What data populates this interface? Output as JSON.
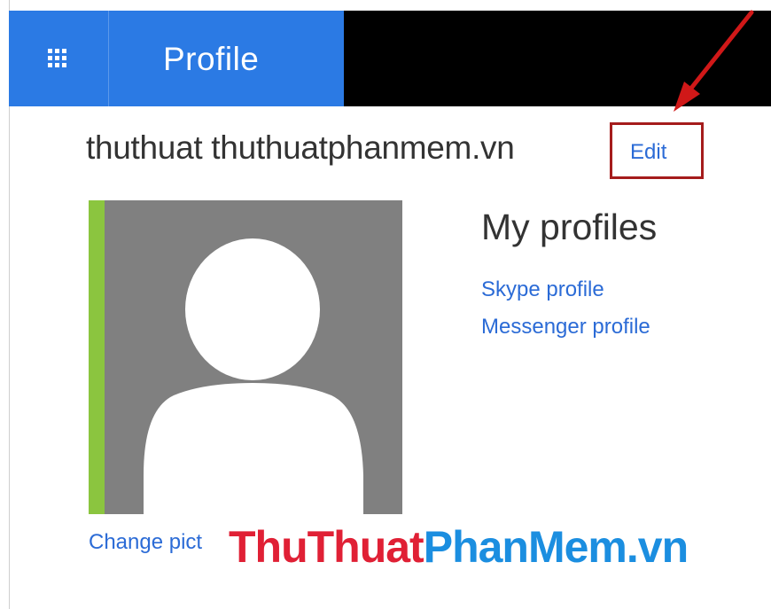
{
  "header": {
    "app_title": "Profile",
    "menu_icon": "waffle-grid-icon",
    "brand_color": "#2b7ae4"
  },
  "profile": {
    "display_name": "thuthuat thuthuatphanmem.vn",
    "edit_label": "Edit",
    "avatar_icon": "person-silhouette-icon",
    "change_picture_label": "Change pict"
  },
  "my_profiles": {
    "title": "My profiles",
    "links": [
      "Skype profile",
      "Messenger profile"
    ]
  },
  "annotation": {
    "highlight_color": "#a51c1c",
    "arrow_icon": "arrow-pointer-icon"
  },
  "watermark": {
    "part1": "ThuThuat",
    "part2": "PhanMem.vn"
  }
}
